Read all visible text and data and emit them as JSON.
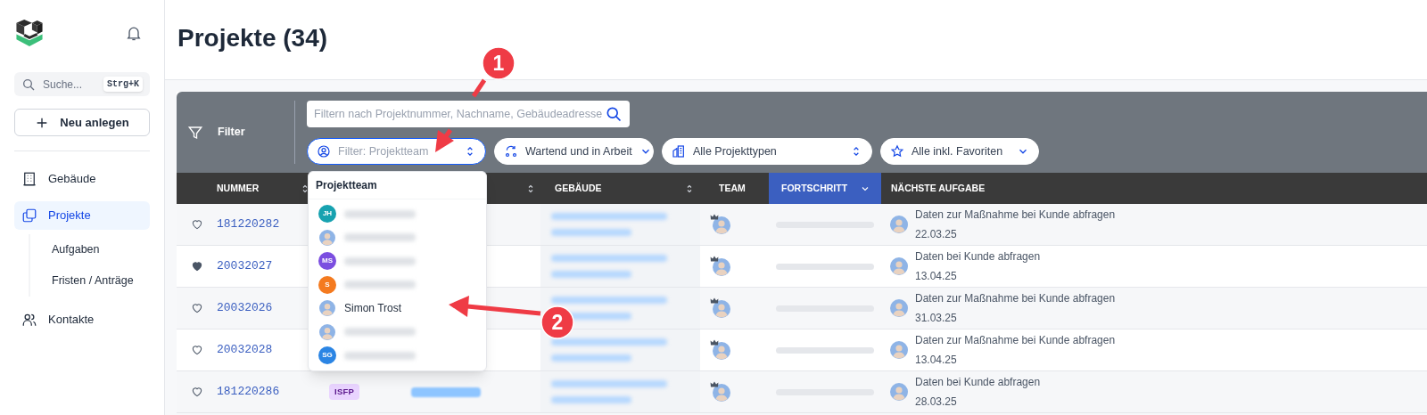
{
  "sidebar": {
    "search": {
      "placeholder": "Suche...",
      "shortcut": "Strg+K"
    },
    "new_button": "Neu anlegen",
    "nav": [
      {
        "label": "Gebäude",
        "selected": false
      },
      {
        "label": "Projekte",
        "selected": true,
        "children": [
          {
            "label": "Aufgaben"
          },
          {
            "label": "Fristen / Anträge"
          }
        ]
      },
      {
        "label": "Kontakte",
        "selected": false
      }
    ]
  },
  "page_title": "Projekte (34)",
  "filter": {
    "label": "Filter",
    "search_placeholder": "Filtern nach Projektnummer, Nachname, Gebäudeadresse",
    "selects": [
      {
        "placeholder": "Filter: Projektteam",
        "focused": true
      },
      {
        "value": "Wartend und in Arbeit",
        "focused": false
      },
      {
        "value": "Alle Projekttypen",
        "focused": false
      },
      {
        "value": "Alle inkl. Favoriten",
        "focused": false
      }
    ]
  },
  "table": {
    "columns": [
      {
        "label": "NUMMER",
        "sortable": true,
        "selected": false
      },
      {
        "sortable": true,
        "selected": false
      },
      {
        "label": "GEBÄUDE",
        "sortable": true,
        "selected": false
      },
      {
        "label": "TEAM",
        "sortable": false,
        "selected": false
      },
      {
        "label": "FORTSCHRITT",
        "sortable": false,
        "selected": true
      },
      {
        "label": "NÄCHSTE AUFGABE",
        "sortable": false,
        "selected": false
      }
    ],
    "rows": [
      {
        "favorite": false,
        "number": "181220282",
        "progress": {
          "level": 0
        },
        "task": "Daten zur Maßnahme bei Kunde abfragen",
        "date": "22.03.25"
      },
      {
        "favorite": true,
        "number": "20032027",
        "progress": {
          "level": 0
        },
        "task": "Daten bei Kunde abfragen",
        "date": "13.04.25"
      },
      {
        "favorite": false,
        "number": "20032026",
        "progress": {
          "level": 0
        },
        "task": "Daten zur Maßnahme bei Kunde abfragen",
        "date": "31.03.25"
      },
      {
        "favorite": false,
        "number": "20032028",
        "progress": {
          "level": 0
        },
        "task": "Daten zur Maßnahme bei Kunde abfragen",
        "date": "13.04.25"
      },
      {
        "favorite": false,
        "number": "181220286",
        "badge": "ISFP",
        "progress": {
          "level": 0
        },
        "task": "Daten bei Kunde abfragen",
        "date": "28.03.25"
      }
    ]
  },
  "dropdown": {
    "title": "Projektteam",
    "items": [
      {
        "kind": "initials",
        "initials": "JH",
        "color": "#17a2b0"
      },
      {
        "kind": "photo"
      },
      {
        "kind": "initials",
        "initials": "MS",
        "color": "#7b4ee0"
      },
      {
        "kind": "initials",
        "initials": "S",
        "color": "#f47a1f"
      },
      {
        "kind": "photo",
        "name": "Simon Trost"
      },
      {
        "kind": "photo"
      },
      {
        "kind": "initials",
        "initials": "SG",
        "color": "#2b85e4"
      }
    ]
  },
  "annotations": [
    {
      "label": "1"
    },
    {
      "label": "2"
    }
  ]
}
